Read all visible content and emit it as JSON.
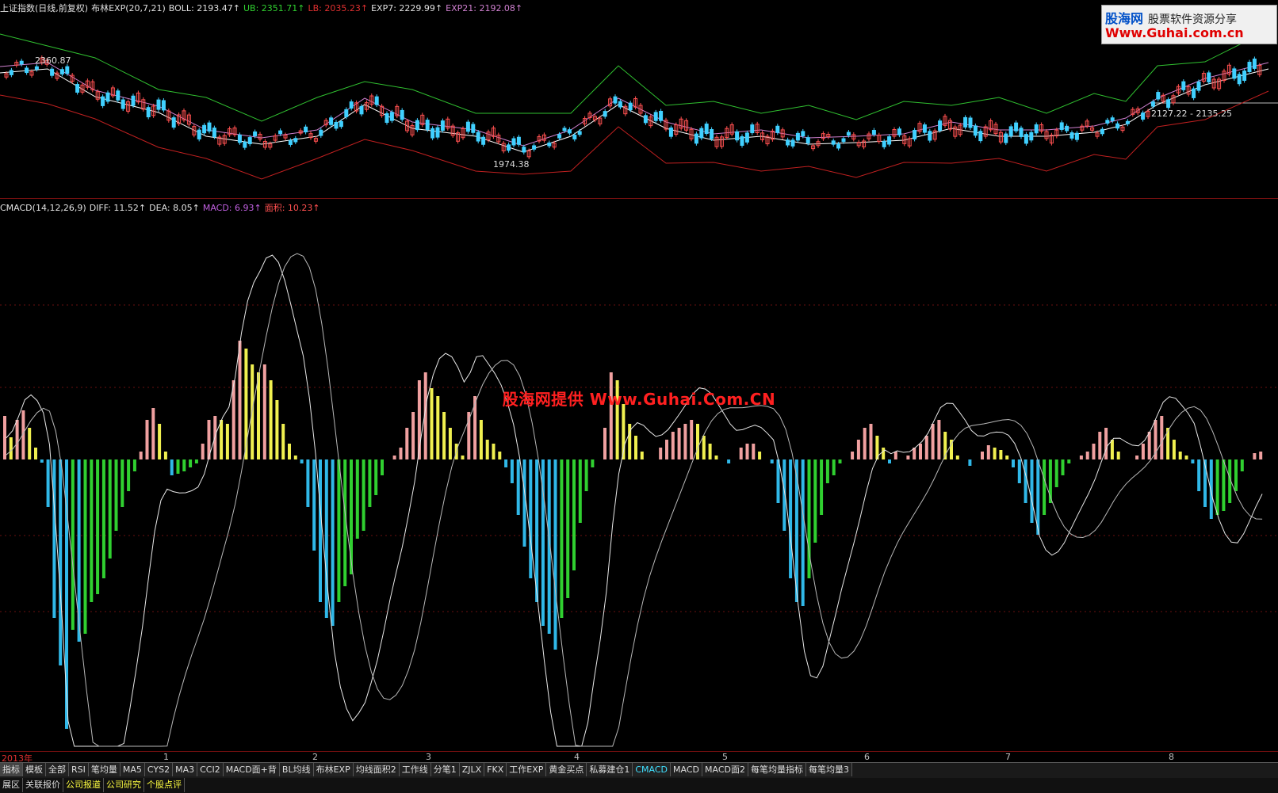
{
  "main_legend": {
    "title": "上证指数(日线,前复权)",
    "indicator": "布林EXP(20,7,21)",
    "boll": "BOLL: 2193.47↑",
    "ub": "UB: 2351.71↑",
    "lb": "LB: 2035.23↑",
    "exp7": "EXP7: 2229.99↑",
    "exp21": "EXP21: 2192.08↑"
  },
  "sub_legend": {
    "name": "CMACD(14,12,26,9)",
    "diff": "DIFF: 11.52↑",
    "dea": "DEA: 8.05↑",
    "macd": "MACD: 6.93↑",
    "area": "面积: 10.23↑"
  },
  "annotations": {
    "high": "2360.87",
    "low": "1974.38",
    "range": "2127.22 - 2135.25"
  },
  "watermark": {
    "center": "股海网提供 Www.Guhai.Com.CN",
    "box_logo": "股海网",
    "box_tag": "股票软件资源分享",
    "box_url": "Www.Guhai.com.cn"
  },
  "x_axis": [
    "2013年",
    "1",
    "2",
    "3",
    "4",
    "5",
    "6",
    "7",
    "8"
  ],
  "tabs": [
    "指标",
    "模板",
    "全部",
    "RSI",
    "笔均量",
    "MA5",
    "CYS2",
    "MA3",
    "CCI2",
    "MACD面+背",
    "BL均线",
    "布林EXP",
    "均线面积2",
    "工作线",
    "分笔1",
    "ZJLX",
    "FKX",
    "工作EXP",
    "黄金买点",
    "私募建仓1",
    "CMACD",
    "MACD",
    "MACD面2",
    "每笔均量指标",
    "每笔均量3"
  ],
  "active_tab": "CMACD",
  "links": [
    "展区",
    "关联报价",
    "公司报道",
    "公司研究",
    "个股点评"
  ],
  "colors": {
    "bg": "#000000",
    "pane_border": "#7a1010",
    "ub": "#30c030",
    "lb": "#c02020",
    "mid": "#ffffff",
    "exp": "#d080d0",
    "candle_up": "#ff5050",
    "candle_down": "#40d0ff",
    "macd_pos_rising": "#f0a0a0",
    "macd_pos_falling": "#f0f050",
    "macd_neg_falling": "#30b8e8",
    "macd_neg_rising": "#30d030"
  },
  "chart_data": {
    "type": "bar",
    "title": "CMACD(14,12,26,9)",
    "series": [
      {
        "name": "MACD",
        "values": [
          55,
          28,
          50,
          62,
          40,
          15,
          -4,
          -60,
          -200,
          -260,
          -340,
          -215,
          -230,
          -220,
          -180,
          -170,
          -150,
          -125,
          -90,
          -60,
          -40,
          -15,
          10,
          50,
          65,
          45,
          10,
          -20,
          -18,
          -15,
          -10,
          -5,
          20,
          50,
          55,
          50,
          45,
          100,
          150,
          140,
          120,
          110,
          120,
          100,
          75,
          45,
          20,
          5,
          -5,
          -60,
          -115,
          -180,
          -200,
          -210,
          -180,
          -160,
          -145,
          -100,
          -90,
          -60,
          -45,
          -20,
          0,
          5,
          15,
          40,
          60,
          100,
          110,
          90,
          80,
          60,
          40,
          20,
          5,
          60,
          80,
          50,
          25,
          20,
          10,
          -10,
          -30,
          -70,
          -110,
          -150,
          -180,
          -210,
          -220,
          -240,
          -200,
          -175,
          -140,
          -80,
          -40,
          -10,
          0,
          40,
          110,
          100,
          70,
          45,
          30,
          10,
          0,
          0,
          15,
          25,
          35,
          40,
          45,
          50,
          45,
          30,
          20,
          5,
          0,
          -5,
          0,
          15,
          20,
          20,
          10,
          0,
          -5,
          -55,
          -90,
          -150,
          -180,
          -185,
          -150,
          -105,
          -70,
          -30,
          -20,
          -5,
          0,
          10,
          25,
          40,
          45,
          30,
          15,
          -5,
          10,
          0,
          5,
          15,
          20,
          30,
          45,
          50,
          35,
          25,
          5,
          0,
          -8,
          0,
          10,
          18,
          15,
          12,
          5,
          -10,
          -30,
          -55,
          -80,
          -95,
          -70,
          -55,
          -35,
          -20,
          -5,
          0,
          5,
          10,
          20,
          35,
          40,
          25,
          10,
          0,
          0,
          5,
          20,
          35,
          50,
          55,
          40,
          25,
          10,
          5,
          -5,
          -40,
          -60,
          -75,
          -70,
          -65,
          -55,
          -40,
          -15,
          0,
          8,
          10
        ]
      }
    ],
    "x_ticks": [
      "2013年",
      "1",
      "2",
      "3",
      "4",
      "5",
      "6",
      "7",
      "8"
    ],
    "grid": true
  }
}
